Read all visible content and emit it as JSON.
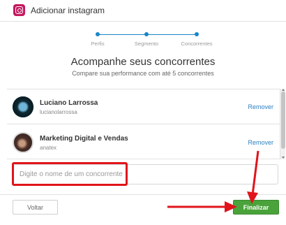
{
  "header": {
    "title": "Adicionar instagram",
    "icon": "instagram-icon"
  },
  "steps": [
    {
      "label": "Perfis"
    },
    {
      "label": "Segmento"
    },
    {
      "label": "Concorrentes"
    }
  ],
  "main": {
    "title": "Acompanhe seus concorrentes",
    "subtitle": "Compare sua performance com até 5 concorrentes"
  },
  "competitors": [
    {
      "name": "Luciano Larrossa",
      "handle": "lucianolarrossa",
      "remove_label": "Remover"
    },
    {
      "name": "Marketing Digital e Vendas",
      "handle": "anatex",
      "remove_label": "Remover"
    }
  ],
  "search": {
    "placeholder": "Digite o nome de um concorrente",
    "value": ""
  },
  "footer": {
    "back_label": "Voltar",
    "finish_label": "Finalizar"
  },
  "colors": {
    "accent": "#1a86c7",
    "finish": "#4aa33a",
    "annotation": "#e0141b",
    "instagram": "#c3185f"
  }
}
